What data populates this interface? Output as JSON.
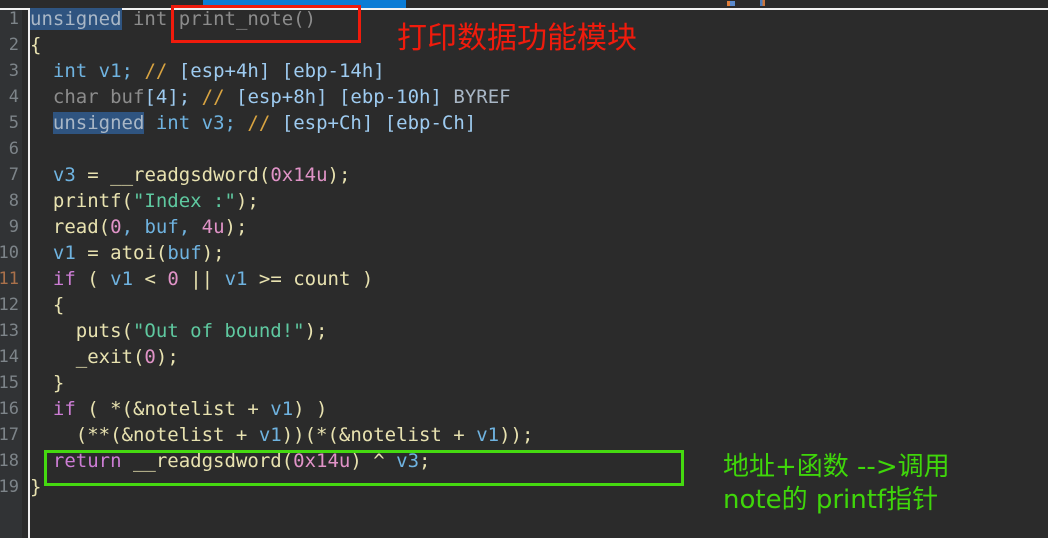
{
  "window": {
    "tab_accent_color": "#0c7cd5",
    "chrome_divider_color": "#f2f2f2",
    "background_color": "#2b2b2b"
  },
  "editor": {
    "kind": "decompiler-pseudocode-view",
    "gutter": {
      "line_numbers": [
        "1",
        "2",
        "3",
        "4",
        "5",
        "6",
        "7",
        "8",
        "9",
        "10",
        "11",
        "12",
        "13",
        "14",
        "15",
        "16",
        "17",
        "18",
        "19"
      ],
      "current_line": "11"
    },
    "lines": [
      {
        "n": "1",
        "text": "unsigned int print_note()"
      },
      {
        "n": "2",
        "text": "{"
      },
      {
        "n": "3",
        "text": "  int v1; // [esp+4h] [ebp-14h]"
      },
      {
        "n": "4",
        "text": "  char buf[4]; // [esp+8h] [ebp-10h] BYREF"
      },
      {
        "n": "5",
        "text": "  unsigned int v3; // [esp+Ch] [ebp-Ch]"
      },
      {
        "n": "6",
        "text": ""
      },
      {
        "n": "7",
        "text": "  v3 = __readgsdword(0x14u);"
      },
      {
        "n": "8",
        "text": "  printf(\"Index :\");"
      },
      {
        "n": "9",
        "text": "  read(0, buf, 4u);"
      },
      {
        "n": "10",
        "text": "  v1 = atoi(buf);"
      },
      {
        "n": "11",
        "text": "  if ( v1 < 0 || v1 >= count )"
      },
      {
        "n": "12",
        "text": "  {"
      },
      {
        "n": "13",
        "text": "    puts(\"Out of bound!\");"
      },
      {
        "n": "14",
        "text": "    _exit(0);"
      },
      {
        "n": "15",
        "text": "  }"
      },
      {
        "n": "16",
        "text": "  if ( *(&notelist + v1) )"
      },
      {
        "n": "17",
        "text": "    (**(&notelist + v1))(*(&notelist + v1));"
      },
      {
        "n": "18",
        "text": "  return __readgsdword(0x14u) ^ v3;"
      },
      {
        "n": "19",
        "text": "}"
      }
    ],
    "tokens": {
      "line1": {
        "t_unsigned": "unsigned",
        "t_int": "int",
        "t_fnname": "print_note()"
      },
      "line2": {
        "brace": "{"
      },
      "line3": {
        "type": "int",
        "name": "v1;",
        "slash": "//",
        "c1": "[esp+4h]",
        "c2": "[ebp-14h]"
      },
      "line4": {
        "type": "char",
        "name": "buf",
        "idx": "[4];",
        "slash": "//",
        "c1": "[esp+8h]",
        "c2": "[ebp-10h]",
        "byref": "BYREF"
      },
      "line5": {
        "t_unsigned": "unsigned",
        "t_int": "int",
        "name": "v3;",
        "slash": "//",
        "c1": "[esp+Ch]",
        "c2": "[ebp-Ch]"
      },
      "line7": {
        "lhs": "v3",
        "eq": "=",
        "fn": "__readgsdword",
        "open": "(",
        "num": "0x14u",
        "close": ");"
      },
      "line8": {
        "fn": "printf",
        "open": "(",
        "str": "\"Index :\"",
        "close": ");"
      },
      "line9": {
        "fn": "read",
        "open": "(",
        "a0": "0",
        "a1": ", buf, ",
        "a2": "4u",
        "close": ");"
      },
      "line10": {
        "lhs": "v1",
        "eq": "=",
        "fn": "atoi",
        "open": "(",
        "arg": "buf",
        "close": ");"
      },
      "line11": {
        "kw": "if",
        "open": "( ",
        "a": "v1",
        "lt": " < ",
        "zero": "0",
        "or": " || ",
        "b": "v1",
        "ge": " >= ",
        "count": "count",
        "close": " )"
      },
      "line12": {
        "brace": "{"
      },
      "line13": {
        "fn": "puts",
        "open": "(",
        "str": "\"Out of bound!\"",
        "close": ");"
      },
      "line14": {
        "fn": "_exit",
        "open": "(",
        "num": "0",
        "close": ");"
      },
      "line15": {
        "brace": "}"
      },
      "line16": {
        "kw": "if",
        "open": "( *(&",
        "global": "notelist",
        "plus": " + ",
        "v": "v1",
        "close": ") )"
      },
      "line17": {
        "open": "(**(&",
        "global": "notelist",
        "plus": " + ",
        "v": "v1",
        "mid": "))(*(&",
        "global2": "notelist",
        "plus2": " + ",
        "v2": "v1",
        "close": "));"
      },
      "line18": {
        "kw": "return",
        "fn": "__readgsdword",
        "open": "(",
        "num": "0x14u",
        "close": ")",
        "xor": " ^ ",
        "v": "v3",
        "semi": ";"
      },
      "line19": {
        "brace": "}"
      }
    },
    "selection_text": "unsigned"
  },
  "annotations": {
    "red": {
      "text": "打印数据功能模块",
      "color": "#f01b0c",
      "box_target": "print_note()"
    },
    "green": {
      "line1": "地址+函数 -->调用",
      "line2": "note的 printf指针",
      "color": "#3fd60a",
      "box_target": "(**(&notelist + v1))(*(&notelist + v1));"
    }
  }
}
